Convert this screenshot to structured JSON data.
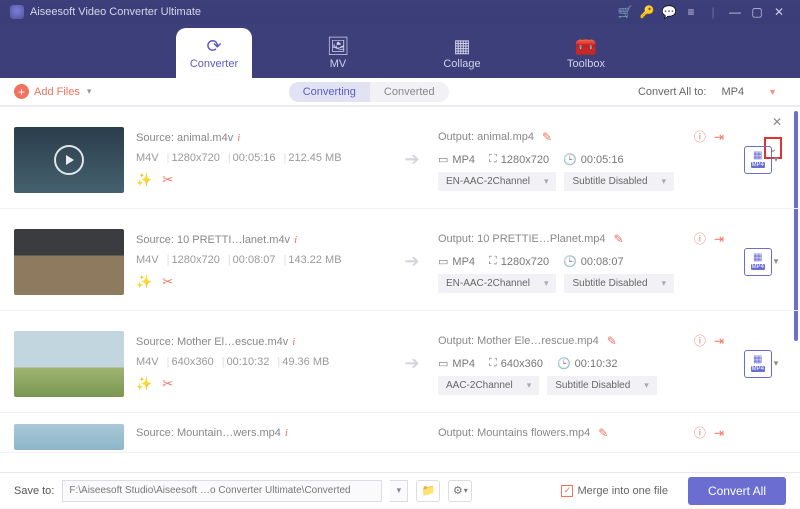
{
  "app": {
    "title": "Aiseesoft Video Converter Ultimate"
  },
  "tabs": {
    "converter": "Converter",
    "mv": "MV",
    "collage": "Collage",
    "toolbox": "Toolbox"
  },
  "toolbar": {
    "add_files": "Add Files",
    "converting": "Converting",
    "converted": "Converted",
    "convert_all_to": "Convert All to:",
    "convert_all_fmt": "MP4"
  },
  "items": [
    {
      "source_label": "Source: animal.m4v",
      "fmt": "M4V",
      "res": "1280x720",
      "dur": "00:05:16",
      "size": "212.45 MB",
      "out_label": "Output: animal.mp4",
      "out_fmt": "MP4",
      "out_res": "1280x720",
      "out_dur": "00:05:16",
      "audio": "EN-AAC-2Channel",
      "subtitle": "Subtitle Disabled"
    },
    {
      "source_label": "Source: 10 PRETTI…lanet.m4v",
      "fmt": "M4V",
      "res": "1280x720",
      "dur": "00:08:07",
      "size": "143.22 MB",
      "out_label": "Output: 10 PRETTIE…Planet.mp4",
      "out_fmt": "MP4",
      "out_res": "1280x720",
      "out_dur": "00:08:07",
      "audio": "EN-AAC-2Channel",
      "subtitle": "Subtitle Disabled"
    },
    {
      "source_label": "Source: Mother El…escue.m4v",
      "fmt": "M4V",
      "res": "640x360",
      "dur": "00:10:32",
      "size": "49.36 MB",
      "out_label": "Output: Mother Ele…rescue.mp4",
      "out_fmt": "MP4",
      "out_res": "640x360",
      "out_dur": "00:10:32",
      "audio": "AAC-2Channel",
      "subtitle": "Subtitle Disabled"
    },
    {
      "source_label": "Source: Mountain…wers.mp4",
      "fmt": "",
      "res": "",
      "dur": "",
      "size": "",
      "out_label": "Output: Mountains flowers.mp4",
      "out_fmt": "",
      "out_res": "",
      "out_dur": "",
      "audio": "",
      "subtitle": ""
    }
  ],
  "format_badge": "MP4",
  "bottom": {
    "save_to": "Save to:",
    "path": "F:\\Aiseesoft Studio\\Aiseesoft …o Converter Ultimate\\Converted",
    "merge": "Merge into one file",
    "convert_all": "Convert All"
  }
}
